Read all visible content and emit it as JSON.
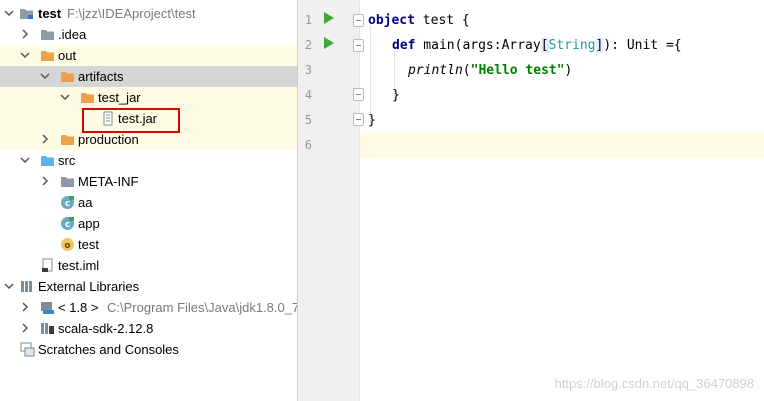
{
  "tree": {
    "root_name": "test",
    "root_path": "F:\\jzz\\IDEAproject\\test",
    "idea": ".idea",
    "out": "out",
    "artifacts": "artifacts",
    "test_jar_dir": "test_jar",
    "test_jar_file": "test.jar",
    "production": "production",
    "src": "src",
    "meta_inf": "META-INF",
    "aa": "aa",
    "app": "app",
    "test_obj": "test",
    "test_iml": "test.iml",
    "external_libraries": "External Libraries",
    "jdk_name": "< 1.8 >",
    "jdk_path": "C:\\Program Files\\Java\\jdk1.8.0_7",
    "scala_sdk": "scala-sdk-2.12.8",
    "scratches": "Scratches and Consoles"
  },
  "editor": {
    "line_numbers": [
      "1",
      "2",
      "3",
      "4",
      "5",
      "6"
    ],
    "l1_kw": "object",
    "l1_rest": " test {",
    "l2_kw": "def",
    "l2_a": " main(args:Array",
    "l2_b": "[",
    "l2_type": "String",
    "l2_c": "]",
    "l2_d": "): Unit ={",
    "l3_fn": "println",
    "l3_open": "(",
    "l3_str": "\"Hello test\"",
    "l3_close": ")",
    "l4": "}",
    "l5": "}"
  },
  "watermark": "https://blog.csdn.net/qq_36470898",
  "colors": {
    "folder": "#8e9aa7",
    "excluded_folder": "#f0a04b",
    "source_folder": "#5ab4e6",
    "selection_row": "#d5d5d5",
    "highlight_row": "#fdfbe3",
    "annotation_box": "#e00000",
    "run_arrow": "#3ea73e",
    "keyword": "#000080",
    "string": "#008000"
  }
}
